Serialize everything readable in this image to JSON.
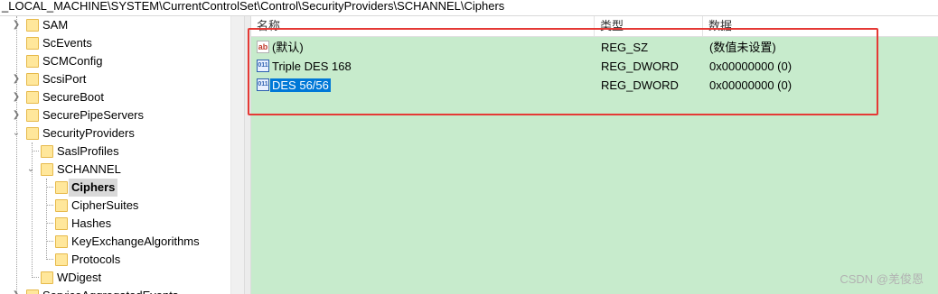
{
  "address_path": "_LOCAL_MACHINE\\SYSTEM\\CurrentControlSet\\Control\\SecurityProviders\\SCHANNEL\\Ciphers",
  "tree": {
    "items": [
      {
        "label": "SAM",
        "expander": "collapsed"
      },
      {
        "label": "ScEvents",
        "expander": "none"
      },
      {
        "label": "SCMConfig",
        "expander": "none"
      },
      {
        "label": "ScsiPort",
        "expander": "collapsed"
      },
      {
        "label": "SecureBoot",
        "expander": "collapsed"
      },
      {
        "label": "SecurePipeServers",
        "expander": "collapsed"
      },
      {
        "label": "SecurityProviders",
        "expander": "expanded"
      },
      {
        "label": "SaslProfiles",
        "expander": "none"
      },
      {
        "label": "SCHANNEL",
        "expander": "expanded"
      },
      {
        "label": "Ciphers",
        "expander": "none",
        "selected": true
      },
      {
        "label": "CipherSuites",
        "expander": "none"
      },
      {
        "label": "Hashes",
        "expander": "none"
      },
      {
        "label": "KeyExchangeAlgorithms",
        "expander": "none"
      },
      {
        "label": "Protocols",
        "expander": "none"
      },
      {
        "label": "WDigest",
        "expander": "none"
      },
      {
        "label": "ServiceAggregatedEvents",
        "expander": "none"
      }
    ]
  },
  "list": {
    "headers": {
      "name": "名称",
      "type": "类型",
      "data": "数据"
    },
    "rows": [
      {
        "icon": "string-value-icon",
        "name": "(默认)",
        "type": "REG_SZ",
        "data": "(数值未设置)"
      },
      {
        "icon": "dword-value-icon",
        "name": "Triple DES 168",
        "type": "REG_DWORD",
        "data": "0x00000000 (0)"
      },
      {
        "icon": "dword-value-icon",
        "name": "DES 56/56",
        "type": "REG_DWORD",
        "data": "0x00000000 (0)",
        "selected": true
      }
    ]
  },
  "colors": {
    "list_background": "#c7ebcc",
    "highlight_border": "#e53935",
    "selection": "#0078d7"
  },
  "watermark": "CSDN @羌俊恩"
}
